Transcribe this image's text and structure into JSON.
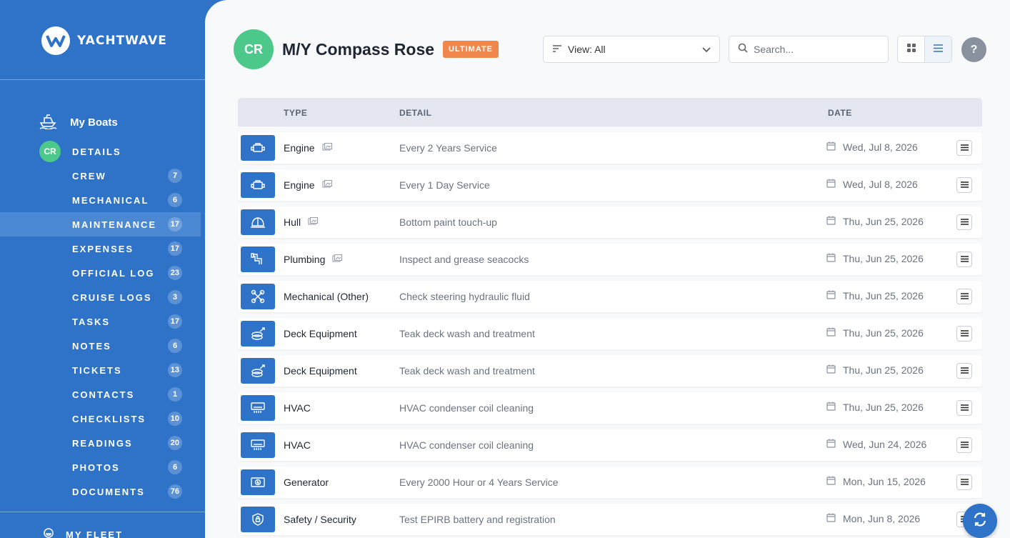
{
  "brand": {
    "name": "YACHTWAVE"
  },
  "sidebar": {
    "my_boats": "My Boats",
    "boat_initials": "CR",
    "details": "DETAILS",
    "items": [
      {
        "label": "CREW",
        "count": "7"
      },
      {
        "label": "MECHANICAL",
        "count": "6"
      },
      {
        "label": "MAINTENANCE",
        "count": "17"
      },
      {
        "label": "EXPENSES",
        "count": "17"
      },
      {
        "label": "OFFICIAL LOG",
        "count": "23"
      },
      {
        "label": "CRUISE LOGS",
        "count": "3"
      },
      {
        "label": "TASKS",
        "count": "17"
      },
      {
        "label": "NOTES",
        "count": "6"
      },
      {
        "label": "TICKETS",
        "count": "13"
      },
      {
        "label": "CONTACTS",
        "count": "1"
      },
      {
        "label": "CHECKLISTS",
        "count": "10"
      },
      {
        "label": "READINGS",
        "count": "20"
      },
      {
        "label": "PHOTOS",
        "count": "6"
      },
      {
        "label": "DOCUMENTS",
        "count": "76"
      }
    ],
    "active_item": "MAINTENANCE",
    "my_fleet": "MY FLEET"
  },
  "header": {
    "initials": "CR",
    "boat_name": "M/Y Compass Rose",
    "tier": "ULTIMATE",
    "view_filter": "View: All",
    "search_placeholder": "Search...",
    "help": "?"
  },
  "table": {
    "columns": {
      "type": "TYPE",
      "detail": "DETAIL",
      "date": "DATE"
    },
    "rows": [
      {
        "type": "Engine",
        "icon": "engine-icon",
        "attachment": true,
        "detail": "Every 2 Years Service",
        "date": "Wed, Jul 8, 2026"
      },
      {
        "type": "Engine",
        "icon": "engine-icon",
        "attachment": true,
        "detail": "Every 1 Day Service",
        "date": "Wed, Jul 8, 2026"
      },
      {
        "type": "Hull",
        "icon": "hull-icon",
        "attachment": true,
        "detail": "Bottom paint touch-up",
        "date": "Thu, Jun 25, 2026"
      },
      {
        "type": "Plumbing",
        "icon": "plumbing-icon",
        "attachment": true,
        "detail": "Inspect and grease seacocks",
        "date": "Thu, Jun 25, 2026"
      },
      {
        "type": "Mechanical (Other)",
        "icon": "mechanical-icon",
        "attachment": false,
        "detail": "Check steering hydraulic fluid",
        "date": "Thu, Jun 25, 2026"
      },
      {
        "type": "Deck Equipment",
        "icon": "deck-equipment-icon",
        "attachment": false,
        "detail": "Teak deck wash and treatment",
        "date": "Thu, Jun 25, 2026"
      },
      {
        "type": "Deck Equipment",
        "icon": "deck-equipment-icon",
        "attachment": false,
        "detail": "Teak deck wash and treatment",
        "date": "Thu, Jun 25, 2026"
      },
      {
        "type": "HVAC",
        "icon": "hvac-icon",
        "attachment": false,
        "detail": "HVAC condenser coil cleaning",
        "date": "Thu, Jun 25, 2026"
      },
      {
        "type": "HVAC",
        "icon": "hvac-icon",
        "attachment": false,
        "detail": "HVAC condenser coil cleaning",
        "date": "Wed, Jun 24, 2026"
      },
      {
        "type": "Generator",
        "icon": "generator-icon",
        "attachment": false,
        "detail": "Every 2000 Hour or 4 Years Service",
        "date": "Mon, Jun 15, 2026"
      },
      {
        "type": "Safety / Security",
        "icon": "safety-icon",
        "attachment": false,
        "detail": "Test EPIRB battery and registration",
        "date": "Mon, Jun 8, 2026"
      }
    ]
  },
  "colors": {
    "primary": "#2f73c9",
    "success": "#4cc98a",
    "tier": "#f0874c",
    "background": "#f8f9fb"
  }
}
